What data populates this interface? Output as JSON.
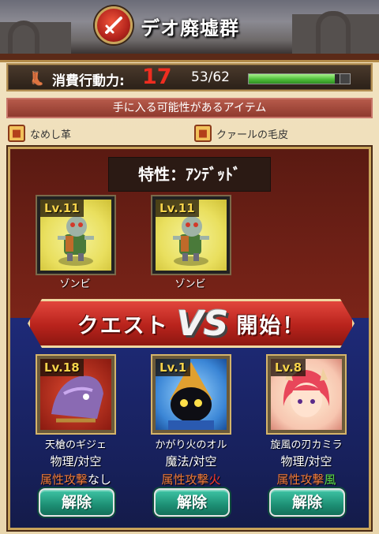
{
  "header": {
    "title": "デオ廃墟群",
    "badge_icon": "sword-icon"
  },
  "stamina": {
    "label": "消費行動力:",
    "cost": "17",
    "current": "53/62",
    "fill_ratio": 0.855
  },
  "items": {
    "header": "手に入る可能性があるアイテム",
    "list": [
      {
        "icon": "leather-icon",
        "label": "なめし革"
      },
      {
        "icon": "fur-icon",
        "label": "クァールの毛皮"
      }
    ]
  },
  "enemies": {
    "trait": "特性：ｱﾝﾃﾞｯﾄﾞ",
    "units": [
      {
        "level": "Lv.11",
        "name": "ゾンビ"
      },
      {
        "level": "Lv.11",
        "name": "ゾンビ"
      }
    ]
  },
  "quest_button": {
    "left": "クエスト",
    "vs": "VS",
    "right": "開始！"
  },
  "party": [
    {
      "level": "Lv.18",
      "name": "天槍のギジェ",
      "role": "物理/対空",
      "attr_label": "属性攻撃",
      "attr_value": "なし",
      "attr_color": "#ffffff",
      "button": "解除"
    },
    {
      "level": "Lv.1",
      "name": "かがり火のオル",
      "role": "魔法/対空",
      "attr_label": "属性攻撃",
      "attr_value": "火",
      "attr_color": "#ff3a2a",
      "button": "解除"
    },
    {
      "level": "Lv.8",
      "name": "旋風の刃カミラ",
      "role": "物理/対空",
      "attr_label": "属性攻撃",
      "attr_value": "風",
      "attr_color": "#5ee34a",
      "button": "解除"
    }
  ]
}
